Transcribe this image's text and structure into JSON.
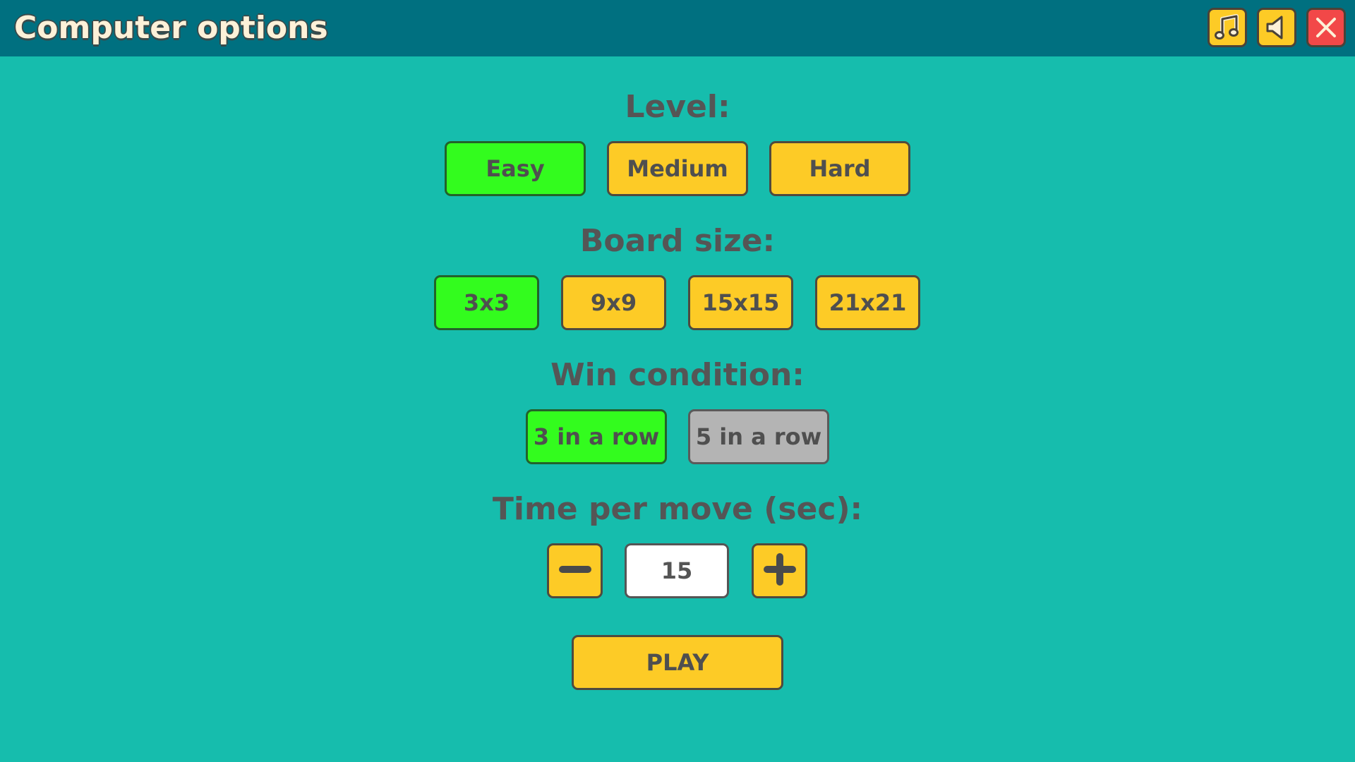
{
  "header": {
    "title": "Computer options",
    "music_icon": "music-note-icon",
    "sound_icon": "speaker-icon",
    "close_icon": "close-x-icon"
  },
  "level": {
    "heading": "Level:",
    "options": [
      "Easy",
      "Medium",
      "Hard"
    ],
    "selected": "Easy"
  },
  "board_size": {
    "heading": "Board size:",
    "options": [
      "3x3",
      "9x9",
      "15x15",
      "21x21"
    ],
    "selected": "3x3"
  },
  "win_condition": {
    "heading": "Win condition:",
    "options": [
      "3 in a row",
      "5 in a row"
    ],
    "selected": "3 in a row",
    "disabled": [
      "5 in a row"
    ]
  },
  "time_per_move": {
    "heading": "Time per move (sec):",
    "value": "15",
    "decrease_icon": "minus-icon",
    "increase_icon": "plus-icon"
  },
  "play": {
    "label": "PLAY"
  },
  "colors": {
    "background": "#16bdad",
    "topbar": "#007080",
    "button": "#fdcb26",
    "selected": "#33fc1e",
    "disabled": "#b4b4b4",
    "close": "#f24848",
    "text": "#555555"
  }
}
